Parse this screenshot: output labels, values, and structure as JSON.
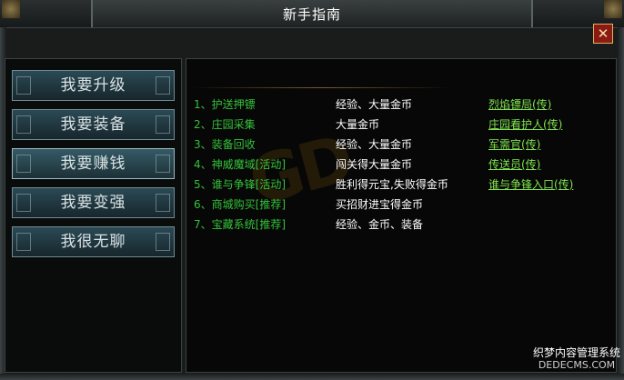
{
  "window": {
    "title": "新手指南",
    "close_label": "✕"
  },
  "menu": {
    "items": [
      {
        "label": "我要升级"
      },
      {
        "label": "我要装备"
      },
      {
        "label": "我要赚钱"
      },
      {
        "label": "我要变强"
      },
      {
        "label": "我很无聊"
      }
    ]
  },
  "guide": {
    "rows": [
      {
        "task": "1、护送押镖",
        "reward": "经验、大量金币",
        "npc": "烈焰镖局(传)"
      },
      {
        "task": "2、庄园采集",
        "reward": "大量金币",
        "npc": "庄园看护人(传)"
      },
      {
        "task": "3、装备回收",
        "reward": "经验、大量金币",
        "npc": "军需官(传)"
      },
      {
        "task": "4、神威魔域[活动]",
        "reward": "闯关得大量金币",
        "npc": "传送员(传)"
      },
      {
        "task": "5、谁与争锋[活动]",
        "reward": "胜利得元宝,失败得金币",
        "npc": "谁与争锋入口(传)"
      },
      {
        "task": "6、商城购买[推荐]",
        "reward": "买招财进宝得金币",
        "npc": ""
      },
      {
        "task": "7、宝藏系统[推荐]",
        "reward": "经验、金币、装备",
        "npc": ""
      }
    ]
  },
  "watermark": {
    "text": "GD"
  },
  "site": {
    "line1": "织梦内容管理系统",
    "line2": "DEDECMS.COM"
  }
}
